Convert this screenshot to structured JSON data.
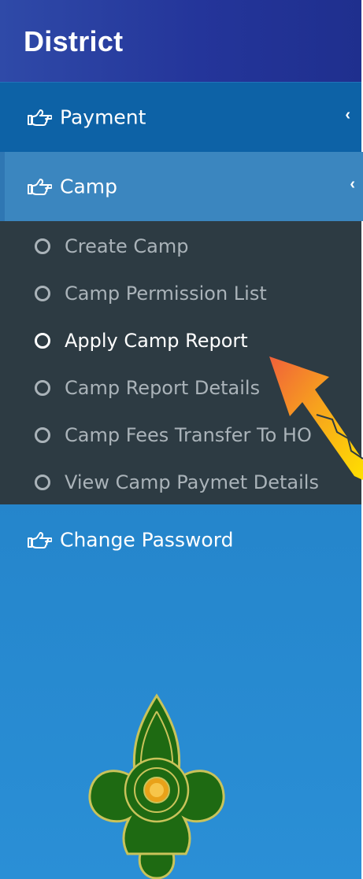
{
  "brand": {
    "title": "District"
  },
  "menu": {
    "payment": {
      "label": "Payment",
      "icon": "hand-pointer-icon"
    },
    "camp": {
      "label": "Camp",
      "icon": "hand-pointer-icon"
    },
    "change_password": {
      "label": "Change Password",
      "icon": "hand-pointer-icon"
    },
    "chevron": "‹"
  },
  "camp_submenu": {
    "items": [
      {
        "label": "Create Camp",
        "active": false
      },
      {
        "label": "Camp Permission List",
        "active": false
      },
      {
        "label": "Apply Camp Report",
        "active": true
      },
      {
        "label": "Camp Report Details",
        "active": false
      },
      {
        "label": "Camp Fees Transfer To HO",
        "active": false
      },
      {
        "label": "View Camp Paymet Details",
        "active": false
      }
    ]
  },
  "colors": {
    "brand_bg": "#24359a",
    "sidebar_bg": "#2586cc",
    "submenu_bg": "#2d3b43",
    "active_text": "#ffffff",
    "inactive_text": "#aab3b9",
    "arrow": "#ffcc00"
  }
}
